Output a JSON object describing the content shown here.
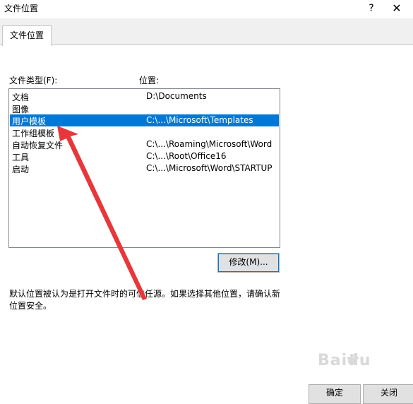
{
  "window": {
    "title": "文件位置",
    "help_glyph": "?",
    "close_glyph": "✕"
  },
  "tabs": [
    {
      "label": "文件位置"
    }
  ],
  "columns": {
    "type_header": "文件类型(F):",
    "location_header": "位置:"
  },
  "rows": [
    {
      "type": "文档",
      "location": "D:\\Documents"
    },
    {
      "type": "图像",
      "location": ""
    },
    {
      "type": "用户模板",
      "location": "C:\\...\\Microsoft\\Templates",
      "selected": true
    },
    {
      "type": "工作组模板",
      "location": ""
    },
    {
      "type": "自动恢复文件",
      "location": "C:\\...\\Roaming\\Microsoft\\Word"
    },
    {
      "type": "工具",
      "location": "C:\\...\\Root\\Office16"
    },
    {
      "type": "启动",
      "location": "C:\\...\\Microsoft\\Word\\STARTUP"
    }
  ],
  "buttons": {
    "modify": "修改(M)...",
    "ok": "确定",
    "cancel": "关闭"
  },
  "note": "默认位置被认为是打开文件时的可信任源。如果选择其他位置，请确认新位置安全。",
  "annotation_color": "#e8373a",
  "selection_color": "#0078d7",
  "watermark": {
    "text": "Baidu"
  }
}
